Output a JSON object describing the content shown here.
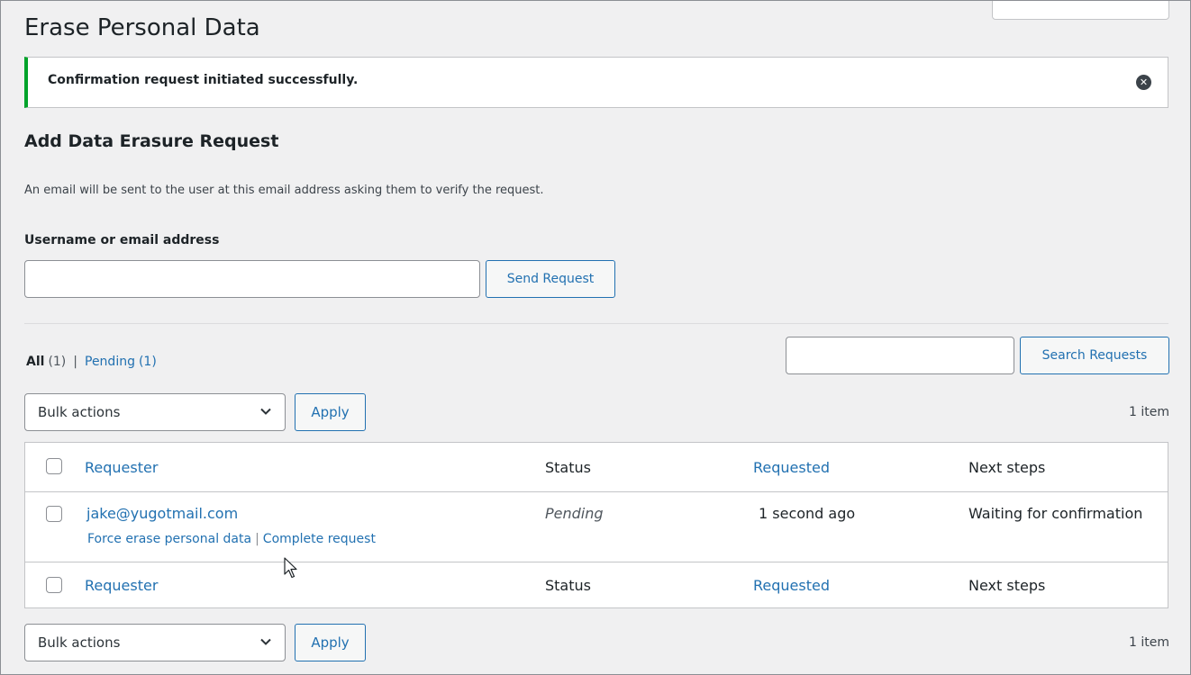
{
  "page": {
    "title": "Erase Personal Data"
  },
  "notice": {
    "message": "Confirmation request initiated successfully.",
    "dismiss_icon": "dismiss-circle-icon",
    "accent_color": "#00a32a"
  },
  "add_request": {
    "heading": "Add Data Erasure Request",
    "description": "An email will be sent to the user at this email address asking them to verify the request.",
    "field_label": "Username or email address",
    "field_value": "",
    "submit_label": "Send Request"
  },
  "filters": {
    "all_label": "All",
    "all_count": "(1)",
    "separator": "|",
    "pending_label": "Pending",
    "pending_count": "(1)"
  },
  "search": {
    "value": "",
    "button_label": "Search Requests"
  },
  "bulk_top": {
    "selected": "Bulk actions",
    "apply_label": "Apply",
    "items_count": "1 item"
  },
  "bulk_bottom": {
    "selected": "Bulk actions",
    "apply_label": "Apply",
    "items_count": "1 item"
  },
  "table": {
    "columns": [
      "Requester",
      "Status",
      "Requested",
      "Next steps"
    ],
    "rows": [
      {
        "requester": "jake@yugotmail.com",
        "status": "Pending",
        "requested": "1 second ago",
        "next_steps": "Waiting for confirmation",
        "actions": [
          "Force erase personal data",
          "Complete request"
        ],
        "action_separator": "|"
      }
    ]
  },
  "colors": {
    "link": "#2271b1",
    "text": "#1d2327",
    "background": "#f0f0f1"
  }
}
